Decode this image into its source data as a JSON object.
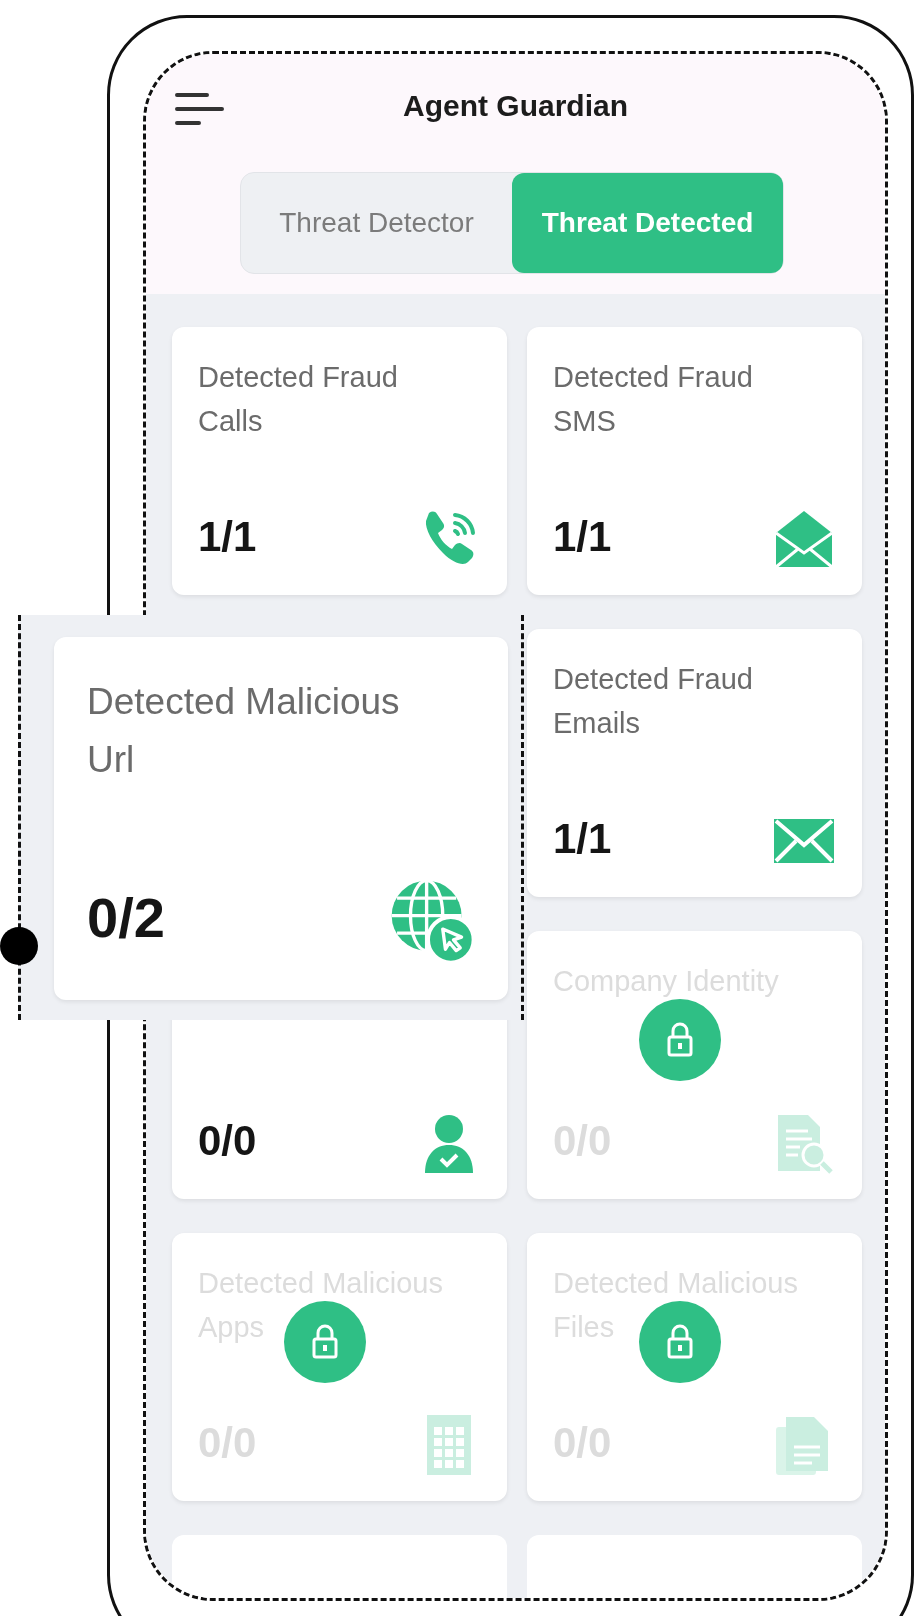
{
  "app_bar": {
    "title": "Agent Guardian"
  },
  "tabs": [
    {
      "label": "Threat Detector",
      "selected": false
    },
    {
      "label": "Threat Detected",
      "selected": true
    }
  ],
  "cards": [
    {
      "kind": "phone",
      "title": "Detected Fraud Calls",
      "count": "1/1",
      "locked": false,
      "magnified": false
    },
    {
      "kind": "envelope-open",
      "title": "Detected Fraud SMS",
      "count": "1/1",
      "locked": false,
      "magnified": false
    },
    {
      "kind": "globe",
      "title": "Detected Malicious Url",
      "count": "0/2",
      "locked": false,
      "magnified": true
    },
    {
      "kind": "envelope",
      "title": "Detected Fraud Emails",
      "count": "1/1",
      "locked": false,
      "magnified": false
    },
    {
      "kind": "person",
      "count": "0/0",
      "locked": false,
      "magnified": false
    },
    {
      "kind": "doc-search",
      "title": "Company Identity",
      "count": "0/0",
      "locked": true,
      "magnified": false
    },
    {
      "kind": "calculator",
      "title": "Detected Malicious Apps",
      "count": "0/0",
      "locked": true,
      "magnified": false
    },
    {
      "kind": "files",
      "title": "Detected Malicious Files",
      "count": "0/0",
      "locked": true,
      "magnified": false
    },
    {
      "kind": "stub"
    },
    {
      "kind": "stub"
    }
  ]
}
